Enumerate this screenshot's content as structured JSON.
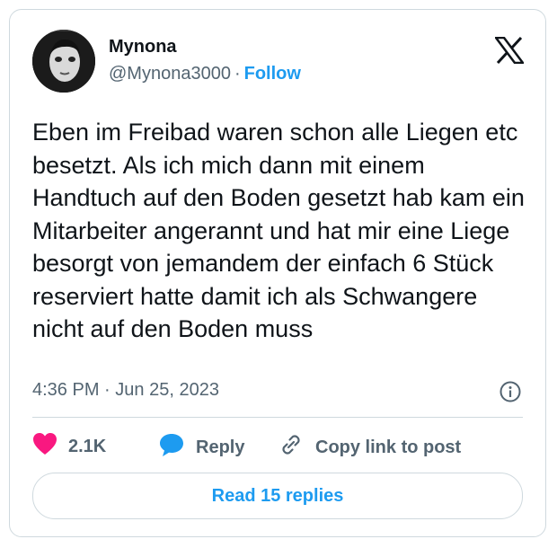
{
  "author": {
    "name": "Mynona",
    "handle": "@Mynona3000",
    "separator": "·",
    "follow_label": "Follow"
  },
  "tweet": {
    "text": "Eben im Freibad waren schon alle Liegen etc besetzt. Als ich mich dann mit einem Handtuch auf den Boden gesetzt hab kam ein Mitarbeiter angerannt und hat mir eine Liege besorgt von jemandem der einfach 6 Stück reserviert hatte damit ich als Schwangere nicht auf den Boden muss",
    "time": "4:36 PM",
    "separator": "·",
    "date": "Jun 25, 2023"
  },
  "actions": {
    "like_count": "2.1K",
    "reply_label": "Reply",
    "copy_link_label": "Copy link to post"
  },
  "read_replies_label": "Read 15 replies",
  "colors": {
    "accent": "#1d9bf0",
    "like": "#f91880",
    "muted": "#536471",
    "border": "#cfd9de"
  },
  "icons": [
    "x-logo-icon",
    "info-icon",
    "heart-icon",
    "reply-bubble-icon",
    "link-icon"
  ]
}
